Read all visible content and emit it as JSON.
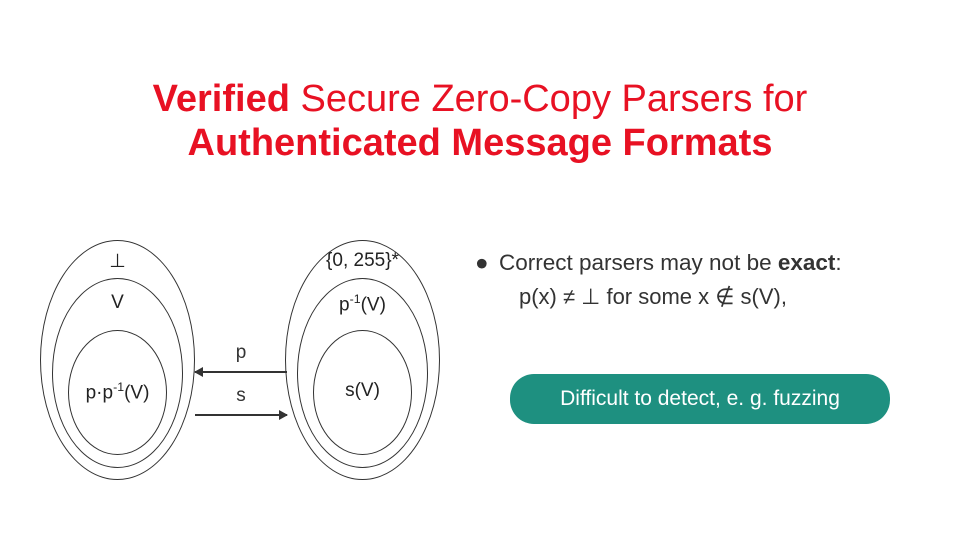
{
  "title": {
    "part1_bold_red": "Verified",
    "part2_red": " Secure Zero-Copy Parsers for",
    "part3_bold_red": "Authenticated Message Formats"
  },
  "diagram": {
    "left": {
      "outer": "⊥",
      "mid": "V",
      "inner_pre": "p·p",
      "inner_sup": "-1",
      "inner_post": "(V)"
    },
    "right": {
      "outer": "{0, 255}*",
      "mid_pre": "p",
      "mid_sup": "-1",
      "mid_post": "(V)",
      "inner": "s(V)"
    },
    "arrows": {
      "top": "p",
      "bottom": "s"
    }
  },
  "bullets": {
    "b1_pre": "Correct parsers may not be ",
    "b1_bold": "exact",
    "b1_post": ":",
    "b1_sub": "p(x) ≠ ⊥ for some x ∉ s(V),"
  },
  "callout": "Difficult to detect, e. g. fuzzing"
}
